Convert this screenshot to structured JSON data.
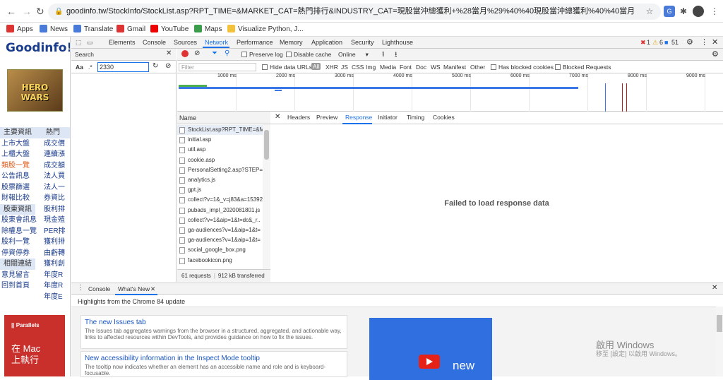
{
  "browser": {
    "url": "goodinfo.tw/StockInfo/StockList.asp?RPT_TIME=&MARKET_CAT=熱門排行&INDUSTRY_CAT=現股當沖總獲利+%28當月%29%40%40現股當沖總獲利%40%40當月",
    "bookmarks": [
      "Apps",
      "News",
      "Translate",
      "Gmail",
      "YouTube",
      "Maps",
      "Visualize Python, J..."
    ]
  },
  "page": {
    "logo": "Goodinfo!",
    "ad_text": "HERO WARS",
    "menu": [
      [
        "主要資訊",
        "熱門"
      ],
      [
        "上市大盤",
        "成交價"
      ],
      [
        "上櫃大盤",
        "連續漲"
      ],
      [
        "類股一覽",
        "成交額"
      ],
      [
        "公告訊息",
        "法人買"
      ],
      [
        "股票篩選",
        "法人一"
      ],
      [
        "財報比較",
        "券資比"
      ],
      [
        "股東資訊",
        "股利排"
      ],
      [
        "股東會訊息",
        "現金殖"
      ],
      [
        "除權息一覽",
        "PER排"
      ],
      [
        "股利一覽",
        "獲利排"
      ],
      [
        "停資停券",
        "由虧轉"
      ],
      [
        "相關連結",
        "獲利創"
      ],
      [
        "意見留言",
        "年度R"
      ],
      [
        "回到首頁",
        "年度R"
      ],
      [
        "",
        "年度E"
      ]
    ],
    "parallels_brand": "|| Parallels",
    "parallels_text": [
      "在 Mac",
      "上執行"
    ]
  },
  "devtools": {
    "tabs": [
      "Elements",
      "Console",
      "Sources",
      "Network",
      "Performance",
      "Memory",
      "Application",
      "Security",
      "Lighthouse"
    ],
    "active_tab": "Network",
    "errors": "1",
    "warnings": "6",
    "messages": "51",
    "search": {
      "title": "Search",
      "aa": "Aa",
      "regex": ".*",
      "query": "2330"
    },
    "toolbar": {
      "preserve_log": "Preserve log",
      "disable_cache": "Disable cache",
      "throttle": "Online"
    },
    "filter": {
      "placeholder": "Filter",
      "hide_data_urls": "Hide data URLs",
      "types": [
        "All",
        "XHR",
        "JS",
        "CSS",
        "Img",
        "Media",
        "Font",
        "Doc",
        "WS",
        "Manifest",
        "Other"
      ],
      "has_blocked_cookies": "Has blocked cookies",
      "blocked_requests": "Blocked Requests"
    },
    "timeline_ticks": [
      "1000 ms",
      "2000 ms",
      "3000 ms",
      "4000 ms",
      "5000 ms",
      "6000 ms",
      "7000 ms",
      "8000 ms",
      "9000 ms"
    ],
    "requests_header": "Name",
    "requests": [
      "StockList.asp?RPT_TIME=&MA",
      "initial.asp",
      "util.asp",
      "cookie.asp",
      "PersonalSetting2.asp?STEP=JS",
      "analytics.js",
      "gpt.js",
      "collect?v=1&_v=j83&a=15392",
      "pubads_impl_2020081801.js",
      "collect?v=1&aip=1&t=dc&_r..",
      "ga-audiences?v=1&aip=1&t=",
      "ga-audiences?v=1&aip=1&t=",
      "social_google_box.png",
      "facebookicon.png"
    ],
    "footer_requests": "61 requests",
    "footer_transferred": "912 kB transferred",
    "detail_tabs": [
      "Headers",
      "Preview",
      "Response",
      "Initiator",
      "Timing",
      "Cookies"
    ],
    "active_detail_tab": "Response",
    "response_message": "Failed to load response data",
    "drawer": {
      "tabs": [
        "Console",
        "What's New"
      ],
      "heading": "Highlights from the Chrome 84 update",
      "cards": [
        {
          "title": "The new Issues tab",
          "desc": "The Issues tab aggregates warnings from the browser in a structured, aggregated, and actionable way, links to affected resources within DevTools, and provides guidance on how to fix the issues."
        },
        {
          "title": "New accessibility information in the Inspect Mode tooltip",
          "desc": "The tooltip now indicates whether an element has an accessible name and role and is keyboard-focusable."
        }
      ],
      "video_label": "new"
    }
  },
  "watermark": {
    "line1": "啟用 Windows",
    "line2": "移至 [設定] 以啟用 Windows。"
  }
}
